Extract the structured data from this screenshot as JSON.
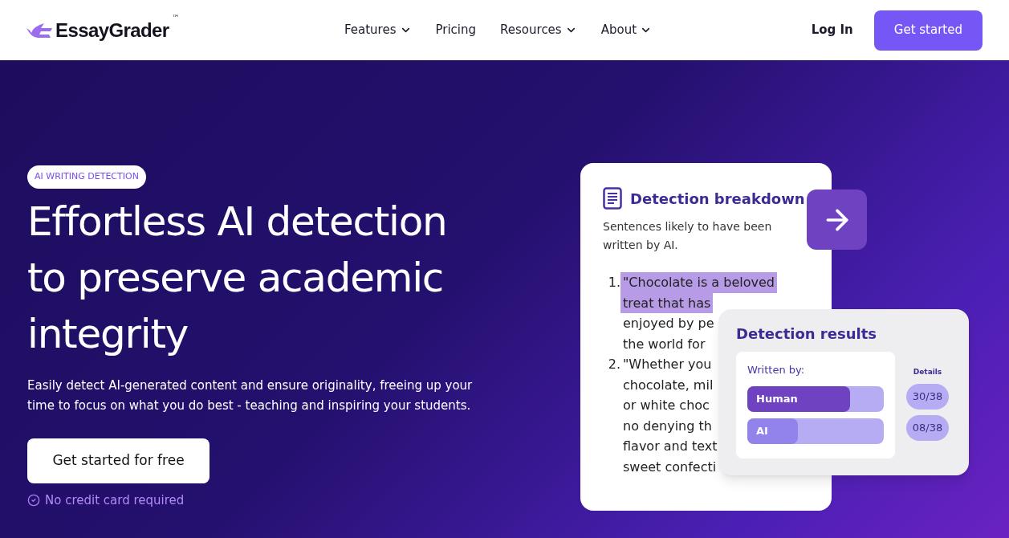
{
  "header": {
    "logo": "EssayGrader",
    "trademark": "™",
    "nav": [
      {
        "label": "Features",
        "dropdown": true
      },
      {
        "label": "Pricing",
        "dropdown": false
      },
      {
        "label": "Resources",
        "dropdown": true
      },
      {
        "label": "About",
        "dropdown": true
      }
    ],
    "login": "Log In",
    "cta": "Get started"
  },
  "hero": {
    "badge": "AI WRITING DETECTION",
    "headline": [
      "Effortless AI detection",
      "to preserve academic",
      "integrity"
    ],
    "description": "Easily detect AI-generated content and ensure originality, freeing up your time to focus on what you do best - teaching and inspiring your students.",
    "cta": "Get started for free",
    "note": "No credit card required"
  },
  "breakdown": {
    "title": "Detection breakdown",
    "subtitle": "Sentences likely to have been written by AI.",
    "items": [
      {
        "number": "1.",
        "highlighted": true,
        "lines": [
          "\"Chocolate is a beloved",
          "treat that has"
        ],
        "after": [
          "enjoyed by pe",
          "the world for"
        ]
      },
      {
        "number": "2.",
        "highlighted": false,
        "lines": [
          "\"Whether you",
          "chocolate, mil",
          "or white choc",
          "no denying th",
          "flavor and text",
          "sweet confecti"
        ]
      }
    ]
  },
  "results": {
    "title": "Detection results",
    "written_by": "Written by:",
    "details_label": "Details",
    "rows": [
      {
        "label": "Human",
        "level": 0.75,
        "count": "30/38",
        "color": "#6f42c1"
      },
      {
        "label": "AI",
        "level": 0.37,
        "count": "08/38",
        "color": "#9283ec"
      }
    ]
  }
}
